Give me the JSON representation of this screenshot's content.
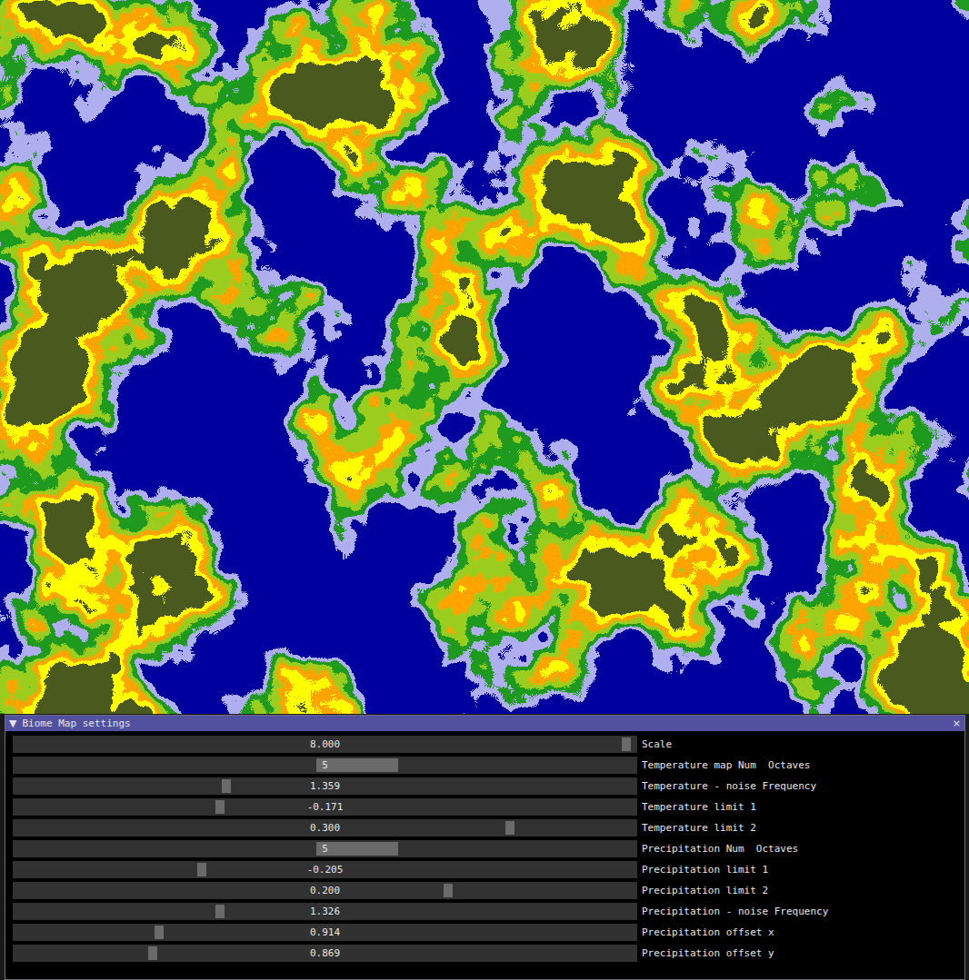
{
  "window": {
    "title": "Biome Map settings",
    "collapse_icon": "▼",
    "close_icon": "×"
  },
  "map": {
    "biomes": [
      {
        "color": "#0000a0"
      },
      {
        "color": "#b0b0f0"
      },
      {
        "color": "#1e9a1e"
      },
      {
        "color": "#9acd1e"
      },
      {
        "color": "#ffa500"
      },
      {
        "color": "#ffff00"
      },
      {
        "color": "#4b5a20"
      }
    ]
  },
  "settings": [
    {
      "label": "Scale",
      "value": "8.000",
      "kind": "float",
      "level": 0.99
    },
    {
      "label": "Temperature map Num  Octaves",
      "value": "5",
      "kind": "int",
      "level": 0.56
    },
    {
      "label": "Temperature - noise Frequency",
      "value": "1.359",
      "kind": "float",
      "level": 0.34
    },
    {
      "label": "Temperature limit 1",
      "value": "-0.171",
      "kind": "float",
      "level": 0.33
    },
    {
      "label": "Temperature limit 2",
      "value": "0.300",
      "kind": "float",
      "level": 0.8
    },
    {
      "label": "Precipitation Num  Octaves",
      "value": "5",
      "kind": "int",
      "level": 0.56
    },
    {
      "label": "Precipitation limit 1",
      "value": "-0.205",
      "kind": "float",
      "level": 0.3
    },
    {
      "label": "Precipitation limit 2",
      "value": "0.200",
      "kind": "float",
      "level": 0.7
    },
    {
      "label": "Precipitation - noise Frequency",
      "value": "1.326",
      "kind": "float",
      "level": 0.33
    },
    {
      "label": "Precipitation offset x",
      "value": "0.914",
      "kind": "float",
      "level": 0.23
    },
    {
      "label": "Precipitation offset y",
      "value": "0.869",
      "kind": "float",
      "level": 0.22
    }
  ]
}
